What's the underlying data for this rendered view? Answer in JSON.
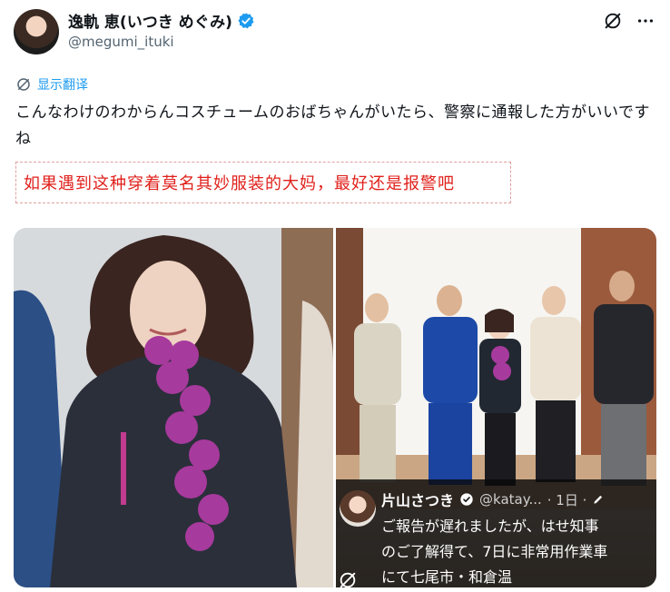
{
  "user": {
    "display_name": "逸軌 恵(いつき めぐみ)",
    "handle": "@megumi_ituki"
  },
  "translate_label": "显示翻译",
  "tweet_text": "こんなわけのわからんコスチュームのおばちゃんがいたら、警察に通報した方がいいですね",
  "translation_text": "如果遇到这种穿着莫名其妙服装的大妈，最好还是报警吧",
  "embedded_post": {
    "name": "片山さつき",
    "handle": "@katay...",
    "time": "· 1日 ·",
    "lines": [
      "ご報告が遅れましたが、はせ知事",
      "のご了解得て、7日に非常用作業車",
      "にて七尾市・和倉温"
    ]
  },
  "icons": {
    "verified": "verified-badge-icon",
    "grok": "grok-icon",
    "more": "more-icon",
    "translate": "translate-icon"
  },
  "colors": {
    "accent": "#1d9bf0",
    "translation": "#e0201b"
  }
}
